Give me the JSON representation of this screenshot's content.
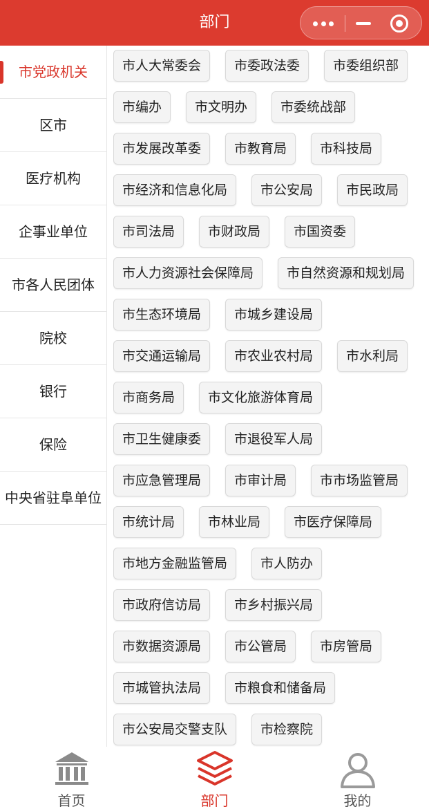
{
  "header": {
    "title": "部门"
  },
  "capsule": {
    "more_icon": "more-dots-icon",
    "minimize_icon": "minimize-icon",
    "close_icon": "target-close-icon"
  },
  "sidebar": {
    "items": [
      {
        "label": "市党政机关",
        "active": true
      },
      {
        "label": "区市",
        "active": false
      },
      {
        "label": "医疗机构",
        "active": false
      },
      {
        "label": "企事业单位",
        "active": false
      },
      {
        "label": "市各人民团体",
        "active": false
      },
      {
        "label": "院校",
        "active": false
      },
      {
        "label": "银行",
        "active": false
      },
      {
        "label": "保险",
        "active": false
      },
      {
        "label": "中央省驻阜单位",
        "active": false
      }
    ]
  },
  "departments": [
    "市人大常委会",
    "市委政法委",
    "市委组织部",
    "市编办",
    "市文明办",
    "市委统战部",
    "市发展改革委",
    "市教育局",
    "市科技局",
    "市经济和信息化局",
    "市公安局",
    "市民政局",
    "市司法局",
    "市财政局",
    "市国资委",
    "市人力资源社会保障局",
    "市自然资源和规划局",
    "市生态环境局",
    "市城乡建设局",
    "市交通运输局",
    "市农业农村局",
    "市水利局",
    "市商务局",
    "市文化旅游体育局",
    "市卫生健康委",
    "市退役军人局",
    "市应急管理局",
    "市审计局",
    "市市场监管局",
    "市统计局",
    "市林业局",
    "市医疗保障局",
    "市地方金融监管局",
    "市人防办",
    "市政府信访局",
    "市乡村振兴局",
    "市数据资源局",
    "市公管局",
    "市房管局",
    "市城管执法局",
    "市粮食和储备局",
    "市公安局交警支队",
    "市检察院"
  ],
  "tabbar": {
    "tabs": [
      {
        "label": "首页",
        "icon": "bank-building-icon",
        "active": false
      },
      {
        "label": "部门",
        "icon": "layers-icon",
        "active": true
      },
      {
        "label": "我的",
        "icon": "user-icon",
        "active": false
      }
    ]
  },
  "colors": {
    "accent": "#dc3b2f",
    "active_text": "#d9352a",
    "tag_bg": "#f4f4f4"
  }
}
